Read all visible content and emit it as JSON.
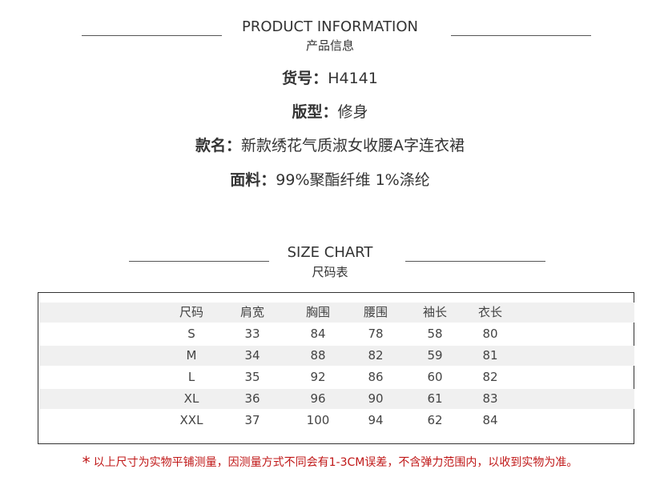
{
  "product_section": {
    "title": "PRODUCT INFORMATION",
    "subtitle": "产品信息"
  },
  "product_info": [
    {
      "label": "货号：",
      "value": "H4141"
    },
    {
      "label": "版型：",
      "value": "修身"
    },
    {
      "label": "款名：",
      "value": "新款绣花气质淑女收腰A字连衣裙"
    },
    {
      "label": "面料：",
      "value": "99%聚酯纤维 1%涤纶"
    }
  ],
  "size_section": {
    "title": "SIZE CHART",
    "subtitle": "尺码表"
  },
  "size_table": {
    "headers": [
      "尺码",
      "肩宽",
      "胸围",
      "腰围",
      "袖长",
      "衣长"
    ],
    "rows": [
      [
        "S",
        "33",
        "84",
        "78",
        "58",
        "80"
      ],
      [
        "M",
        "34",
        "88",
        "82",
        "59",
        "81"
      ],
      [
        "L",
        "35",
        "92",
        "86",
        "60",
        "82"
      ],
      [
        "XL",
        "36",
        "96",
        "90",
        "61",
        "83"
      ],
      [
        "XXL",
        "37",
        "100",
        "94",
        "62",
        "84"
      ]
    ]
  },
  "note": {
    "star": "*",
    "text": "以上尺寸为实物平铺测量，因测量方式不同会有1-3CM误差，不含弹力范围内，以收到实物为准。"
  },
  "colors": {
    "text": "#333333",
    "note": "#c01818",
    "row_shade": "#f0f0f0"
  }
}
